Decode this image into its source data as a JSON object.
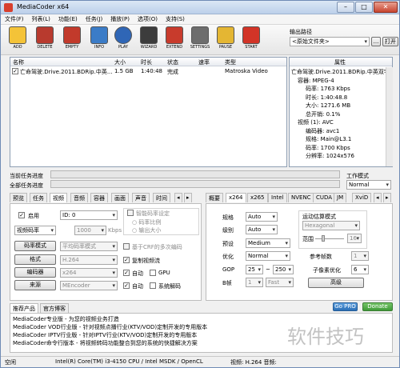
{
  "window": {
    "title": "MediaCoder x64"
  },
  "menu": [
    "文件(F)",
    "列表(L)",
    "功能(E)",
    "任务(J)",
    "播放(P)",
    "选项(O)",
    "支持(S)"
  ],
  "toolbar": [
    {
      "label": "ADD",
      "icon": "add-icon",
      "color": "#f4c338"
    },
    {
      "label": "DELETE",
      "icon": "delete-icon",
      "color": "#b83a2e"
    },
    {
      "label": "EMPTY",
      "icon": "empty-icon",
      "color": "#c23a2b"
    },
    {
      "label": "INFO",
      "icon": "info-icon",
      "color": "#3b7cc7"
    },
    {
      "label": "PLAY",
      "icon": "play-icon",
      "color": "#2f66b6"
    },
    {
      "label": "WIZARD",
      "icon": "wizard-icon",
      "color": "#3c3c3c"
    },
    {
      "label": "EXTEND",
      "icon": "extend-icon",
      "color": "#c83b2c"
    },
    {
      "label": "SETTINGS",
      "icon": "settings-icon",
      "color": "#6d6d6d"
    },
    {
      "label": "PAUSE",
      "icon": "pause-icon",
      "color": "#e4b633"
    },
    {
      "label": "START",
      "icon": "start-icon",
      "color": "#d23427"
    }
  ],
  "output": {
    "label": "输出路径",
    "value": "<原始文件夹>",
    "browse": "...",
    "open": "打开"
  },
  "filelist": {
    "columns": [
      "名称",
      "大小",
      "时长",
      "状态",
      "速率",
      "类型"
    ],
    "rows": [
      {
        "checked": "✓",
        "name": "亡命驾驶.Drive.2011.BDRip.中英...",
        "size": "1.5 GB",
        "duration": "1:40:48",
        "status": "完成",
        "rate": "",
        "type": "Matroska Video"
      }
    ]
  },
  "properties": {
    "header": "属性",
    "lines": [
      "亡命驾驶.Drive.2011.BDRip.中英双字.mkv",
      "容器: MPEG-4",
      "码率: 1763 Kbps",
      "时长: 1:40:48.8",
      "大小: 1271.6 MB",
      "总开销: 0.1%",
      "视频 (1): AVC",
      "编码器: avc1",
      "规格: Main@L3.1",
      "码率: 1700 Kbps",
      "分辨率: 1024x576"
    ]
  },
  "progress": {
    "current_label": "当前任务进度",
    "total_label": "全部任务进度",
    "current": 0,
    "total": 0
  },
  "workmode": {
    "label": "工作模式",
    "value": "Normal"
  },
  "left_tabs": [
    "预览",
    "任务",
    "视频",
    "音频",
    "容器",
    "画面",
    "声音",
    "时间"
  ],
  "right_tabs": [
    "概要",
    "x264",
    "x265",
    "Intel",
    "NVENC",
    "CUDA",
    "JM",
    "XviD"
  ],
  "video": {
    "enable_label": "启用",
    "enable_checked": "✓",
    "id_value": "ID: 0",
    "smart_rate": "智能码率设定",
    "rate_ratio": "码率比例",
    "output_size": "输出大小",
    "rate_mode": "视频码率",
    "rate_value": "1000",
    "rate_unit": "Kbps",
    "rate_mode_btn": "码率模式",
    "rate_mode_value": "平均码率模式",
    "crf_label": "基于CRF的多次编码",
    "format_btn": "格式",
    "format_value": "H.264",
    "copy_stream": "复制视频流",
    "copy_checked": "✓",
    "encoder_btn": "编码器",
    "encoder_value": "x264",
    "auto1": "自动",
    "auto1_checked": "✓",
    "gpu": "GPU",
    "source_btn": "来源",
    "source_value": "MEncoder",
    "auto2": "自动",
    "auto2_checked": "✓",
    "sysdecode": "系统解码"
  },
  "x264": {
    "profile_label": "规格",
    "profile_value": "Auto",
    "level_label": "级别",
    "level_value": "Auto",
    "preset_label": "预设",
    "preset_value": "Medium",
    "tune_label": "优化",
    "tune_value": "Normal",
    "gop_label": "GOP",
    "gop_min": "25",
    "gop_sep": "~",
    "gop_max": "250",
    "bframe_label": "B帧",
    "bframe_value": "1",
    "bframe_mode": "Fast",
    "motion_label": "运动估算模式",
    "motion_value": "Hexagonal",
    "range_label": "范围",
    "range_value": "16",
    "ref_label": "参考帧数",
    "ref_value": "1",
    "subpel_label": "子像素优化",
    "subpel_value": "6",
    "advanced": "高级"
  },
  "bottom": {
    "tabs": [
      "推荐产品",
      "官方博客"
    ],
    "gopro": "Go PRO",
    "donate": "Donate",
    "lines": [
      "MediaCoder专业版 - 为您的视频业务打造",
      "MediaCoder VOD行业版 - 针对视频点播行业(KTV/VOD)定制开发的专用版本",
      "MediaCoder IPTV行业版 - 针对IPTV行业(KTV/VOD)定制开发的专用版本",
      "MediaCoder命令行版本 - 将视频转码功能整合到您的系统的快捷解决方案"
    ]
  },
  "status": {
    "state": "空闲",
    "cpu": "Intel(R) Core(TM) i3-4150 CPU  / Intel MSDK / OpenCL",
    "video": "视频: H.264  音频:"
  },
  "watermark": "软件技巧"
}
